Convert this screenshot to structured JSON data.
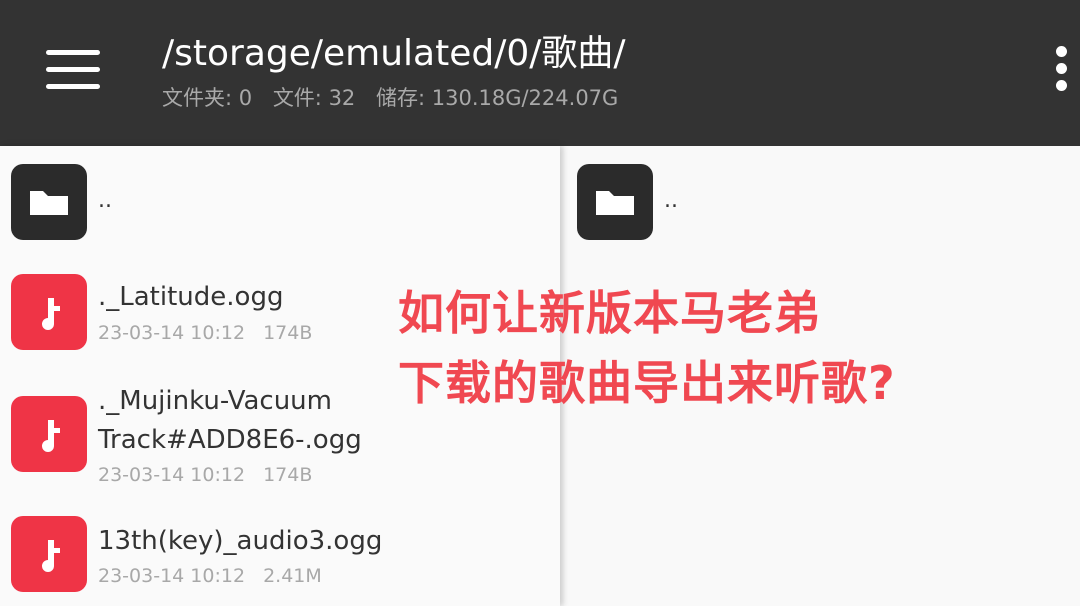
{
  "header": {
    "path": "/storage/emulated/0/歌曲/",
    "folders": "文件夹: 0",
    "files": "文件: 32",
    "storage": "储存: 130.18G/224.07G"
  },
  "left_pane": {
    "up_label": "..",
    "files": [
      {
        "name_lines": [
          "._Latitude.ogg"
        ],
        "date": "23-03-14 10:12",
        "size": "174B"
      },
      {
        "name_lines": [
          "._Mujinku-Vacuum",
          "Track#ADD8E6-.ogg"
        ],
        "date": "23-03-14 10:12",
        "size": "174B"
      },
      {
        "name_lines": [
          "13th(key)_audio3.ogg"
        ],
        "date": "23-03-14 10:12",
        "size": "2.41M"
      }
    ]
  },
  "right_pane": {
    "up_label": ".."
  },
  "overlay": {
    "line1": "如何让新版本马老弟",
    "line2": "下载的歌曲导出来听歌?"
  },
  "icons": {
    "menu": "hamburger-menu-icon",
    "overflow": "more-vert-icon",
    "folder": "folder-icon",
    "music": "music-note-icon"
  },
  "colors": {
    "toolbar": "#333333",
    "music_tile": "#ef3446",
    "folder_tile": "#2b2b2b",
    "overlay_text": "#f04851"
  }
}
